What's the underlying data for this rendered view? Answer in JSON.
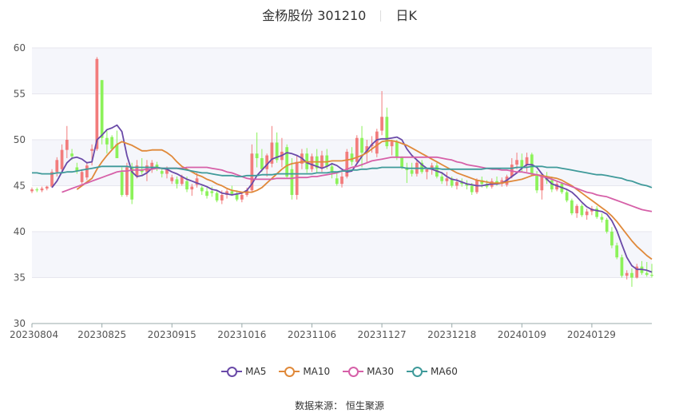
{
  "title": {
    "name": "金杨股份 301210",
    "period": "日K"
  },
  "source": "数据来源： 恒生聚源",
  "colors": {
    "up": "#f27c7c",
    "down": "#8cf25a",
    "ma5": "#6a4aa8",
    "ma10": "#e0893a",
    "ma30": "#d660a8",
    "ma60": "#3f9a9a",
    "grid": "#e6e6ee",
    "band": "#f5f6fb"
  },
  "chart_data": {
    "type": "candlestick",
    "ylim": [
      30,
      60
    ],
    "yticks": [
      30,
      35,
      40,
      45,
      50,
      55,
      60
    ],
    "xtick_labels": [
      "20230804",
      "20230825",
      "20230915",
      "20231016",
      "20231106",
      "20231127",
      "20231218",
      "20240109",
      "20240129"
    ],
    "xtick_index": [
      0,
      14,
      28,
      42,
      56,
      70,
      84,
      98,
      112
    ],
    "candles": [
      [
        44.4,
        44.8,
        44.2,
        44.6
      ],
      [
        44.6,
        44.8,
        44.3,
        44.5
      ],
      [
        44.5,
        44.9,
        44.3,
        44.7
      ],
      [
        44.7,
        45.0,
        44.5,
        44.9
      ],
      [
        44.9,
        46.8,
        44.8,
        46.5
      ],
      [
        46.5,
        48.1,
        46.0,
        47.8
      ],
      [
        46.8,
        49.5,
        46.5,
        48.9
      ],
      [
        48.9,
        51.5,
        48.0,
        50.0
      ],
      [
        48.5,
        49.0,
        47.8,
        48.2
      ],
      [
        47.0,
        47.5,
        46.3,
        46.6
      ],
      [
        45.4,
        46.8,
        45.2,
        46.5
      ],
      [
        45.9,
        47.6,
        45.6,
        47.2
      ],
      [
        48.8,
        49.5,
        47.2,
        49.0
      ],
      [
        49.0,
        59.0,
        48.8,
        58.8
      ],
      [
        56.5,
        56.5,
        49.5,
        50.2
      ],
      [
        50.2,
        51.0,
        48.5,
        49.5
      ],
      [
        50.3,
        50.5,
        48.9,
        49.0
      ],
      [
        49.5,
        51.0,
        48.0,
        48.0
      ],
      [
        46.5,
        47.0,
        43.8,
        44.0
      ],
      [
        44.0,
        47.5,
        43.8,
        47.0
      ],
      [
        47.0,
        47.5,
        43.0,
        43.5
      ],
      [
        46.0,
        47.8,
        45.8,
        47.2
      ],
      [
        46.8,
        48.0,
        46.2,
        46.5
      ],
      [
        46.5,
        47.8,
        45.5,
        47.2
      ],
      [
        47.0,
        47.8,
        46.4,
        47.5
      ],
      [
        47.3,
        47.6,
        46.6,
        47.0
      ],
      [
        46.6,
        47.0,
        45.9,
        46.3
      ],
      [
        46.3,
        47.1,
        45.8,
        46.9
      ],
      [
        45.5,
        46.2,
        45.2,
        45.9
      ],
      [
        45.7,
        46.0,
        44.7,
        45.2
      ],
      [
        45.2,
        46.2,
        45.0,
        46.0
      ],
      [
        45.5,
        46.0,
        44.3,
        44.6
      ],
      [
        44.6,
        45.2,
        43.9,
        44.9
      ],
      [
        45.1,
        46.4,
        44.8,
        45.8
      ],
      [
        44.8,
        45.0,
        44.0,
        44.4
      ],
      [
        44.4,
        44.8,
        43.6,
        43.9
      ],
      [
        44.4,
        44.9,
        43.8,
        44.2
      ],
      [
        44.2,
        44.5,
        43.2,
        43.4
      ],
      [
        43.4,
        44.5,
        43.0,
        44.0
      ],
      [
        44.0,
        44.6,
        43.6,
        44.4
      ],
      [
        44.4,
        45.0,
        43.9,
        44.1
      ],
      [
        44.1,
        44.5,
        43.3,
        43.5
      ],
      [
        43.5,
        44.3,
        43.2,
        44.0
      ],
      [
        44.0,
        44.8,
        43.8,
        44.5
      ],
      [
        44.5,
        49.5,
        44.3,
        48.5
      ],
      [
        48.5,
        50.8,
        47.0,
        48.0
      ],
      [
        48.0,
        49.0,
        46.5,
        46.8
      ],
      [
        46.8,
        48.5,
        46.0,
        48.3
      ],
      [
        47.4,
        51.5,
        47.0,
        49.7
      ],
      [
        49.7,
        50.8,
        47.5,
        47.8
      ],
      [
        47.8,
        50.2,
        47.0,
        48.7
      ],
      [
        49.2,
        49.5,
        45.8,
        46.0
      ],
      [
        46.8,
        48.0,
        43.5,
        44.0
      ],
      [
        44.0,
        48.3,
        43.5,
        47.6
      ],
      [
        47.4,
        49.0,
        46.8,
        48.5
      ],
      [
        48.5,
        49.1,
        46.4,
        46.8
      ],
      [
        46.8,
        48.5,
        46.5,
        48.2
      ],
      [
        48.2,
        49.0,
        46.4,
        46.9
      ],
      [
        46.9,
        48.8,
        46.5,
        48.3
      ],
      [
        48.3,
        49.0,
        46.8,
        47.1
      ],
      [
        47.1,
        47.5,
        45.8,
        46.4
      ],
      [
        45.8,
        46.4,
        45.0,
        45.2
      ],
      [
        45.2,
        46.5,
        44.8,
        46.0
      ],
      [
        46.0,
        49.0,
        45.8,
        48.7
      ],
      [
        48.5,
        49.2,
        47.2,
        47.6
      ],
      [
        47.6,
        50.5,
        47.4,
        50.2
      ],
      [
        50.2,
        51.5,
        47.0,
        48.6
      ],
      [
        48.6,
        50.0,
        47.5,
        49.3
      ],
      [
        49.3,
        50.4,
        48.6,
        49.5
      ],
      [
        48.5,
        51.2,
        48.1,
        50.9
      ],
      [
        51.0,
        55.3,
        50.5,
        52.5
      ],
      [
        52.5,
        53.5,
        49.0,
        49.3
      ],
      [
        49.3,
        50.0,
        48.3,
        49.8
      ],
      [
        49.8,
        50.0,
        47.8,
        48.1
      ],
      [
        48.1,
        48.2,
        46.8,
        47.0
      ],
      [
        47.0,
        47.5,
        45.3,
        46.7
      ],
      [
        46.7,
        47.5,
        46.0,
        46.3
      ],
      [
        46.3,
        47.8,
        46.0,
        47.5
      ],
      [
        47.5,
        47.8,
        46.3,
        46.5
      ],
      [
        46.5,
        47.0,
        45.7,
        46.8
      ],
      [
        46.8,
        47.5,
        46.2,
        47.2
      ],
      [
        47.2,
        47.5,
        45.8,
        46.0
      ],
      [
        46.0,
        46.5,
        45.2,
        45.5
      ],
      [
        45.5,
        46.5,
        45.0,
        45.8
      ],
      [
        45.8,
        46.0,
        44.8,
        45.0
      ],
      [
        45.0,
        45.8,
        44.6,
        45.4
      ],
      [
        45.4,
        45.8,
        44.9,
        45.2
      ],
      [
        45.2,
        45.6,
        44.6,
        45.0
      ],
      [
        45.0,
        45.3,
        44.0,
        44.3
      ],
      [
        44.3,
        45.8,
        44.1,
        45.6
      ],
      [
        45.6,
        46.0,
        44.8,
        45.2
      ],
      [
        45.2,
        45.6,
        44.7,
        44.9
      ],
      [
        44.9,
        45.8,
        44.7,
        45.5
      ],
      [
        45.5,
        46.0,
        45.0,
        45.2
      ],
      [
        45.2,
        45.9,
        44.9,
        45.6
      ],
      [
        45.1,
        46.2,
        44.9,
        46.0
      ],
      [
        46.0,
        48.0,
        45.8,
        47.3
      ],
      [
        47.3,
        48.6,
        46.8,
        47.8
      ],
      [
        47.8,
        48.5,
        46.5,
        47.0
      ],
      [
        47.3,
        48.6,
        46.5,
        48.1
      ],
      [
        48.4,
        48.6,
        46.1,
        46.2
      ],
      [
        46.1,
        46.6,
        44.2,
        44.5
      ],
      [
        44.5,
        46.2,
        43.5,
        46.0
      ],
      [
        46.0,
        46.5,
        45.2,
        45.6
      ],
      [
        45.6,
        46.0,
        44.3,
        44.6
      ],
      [
        44.6,
        45.5,
        44.4,
        45.2
      ],
      [
        45.2,
        45.4,
        44.1,
        44.3
      ],
      [
        44.3,
        44.6,
        43.2,
        43.4
      ],
      [
        43.4,
        43.6,
        41.8,
        42.0
      ],
      [
        42.0,
        43.0,
        41.5,
        42.8
      ],
      [
        42.8,
        43.0,
        41.6,
        41.8
      ],
      [
        41.8,
        42.5,
        41.3,
        42.2
      ],
      [
        42.2,
        42.8,
        41.8,
        42.5
      ],
      [
        42.5,
        42.8,
        41.4,
        41.6
      ],
      [
        41.6,
        42.0,
        41.0,
        41.3
      ],
      [
        41.3,
        41.5,
        39.8,
        40.0
      ],
      [
        40.0,
        40.5,
        38.2,
        38.5
      ],
      [
        38.5,
        38.8,
        37.0,
        37.2
      ],
      [
        37.2,
        37.5,
        35.0,
        35.2
      ],
      [
        35.2,
        35.8,
        34.8,
        35.5
      ],
      [
        35.5,
        36.0,
        34.0,
        35.0
      ],
      [
        35.0,
        36.5,
        34.9,
        36.2
      ],
      [
        36.2,
        36.8,
        35.3,
        35.5
      ],
      [
        35.5,
        36.7,
        35.1,
        35.3
      ],
      [
        35.3,
        36.5,
        35.0,
        35.2
      ]
    ],
    "series": [
      {
        "name": "MA5",
        "color": "#6a4aa8",
        "values": [
          null,
          null,
          null,
          null,
          44.8,
          45.5,
          46.5,
          47.5,
          48.0,
          48.1,
          47.9,
          47.5,
          47.6,
          50.0,
          50.5,
          51.1,
          51.3,
          51.6,
          50.9,
          48.3,
          46.5,
          46.0,
          46.1,
          46.4,
          46.9,
          47.0,
          46.9,
          46.8,
          46.5,
          46.3,
          46.0,
          45.7,
          45.5,
          45.3,
          45.1,
          44.9,
          44.6,
          44.5,
          44.2,
          44.1,
          44.0,
          44.1,
          44.2,
          44.5,
          45.2,
          46.1,
          46.7,
          47.3,
          47.9,
          48.1,
          48.3,
          48.6,
          48.5,
          48.3,
          48.0,
          47.5,
          47.3,
          47.1,
          46.9,
          47.1,
          47.4,
          47.2,
          46.8,
          46.5,
          46.6,
          47.4,
          48.2,
          48.8,
          49.5,
          50.0,
          50.1,
          50.1,
          50.2,
          50.3,
          50.0,
          49.0,
          48.3,
          47.8,
          47.3,
          46.9,
          46.8,
          46.6,
          46.4,
          46.0,
          45.7,
          45.6,
          45.4,
          45.2,
          45.1,
          45.0,
          45.0,
          45.1,
          45.2,
          45.2,
          45.3,
          45.6,
          46.0,
          46.4,
          46.9,
          47.3,
          47.3,
          47.0,
          46.3,
          45.7,
          45.2,
          45.0,
          44.8,
          44.6,
          44.3,
          43.8,
          43.2,
          42.7,
          42.4,
          42.3,
          42.2,
          41.9,
          41.2,
          40.1,
          38.6,
          37.2,
          36.3,
          35.9,
          35.9,
          35.8,
          35.6
        ]
      },
      {
        "name": "MA10",
        "color": "#e0893a",
        "values": [
          null,
          null,
          null,
          null,
          null,
          null,
          null,
          null,
          null,
          44.6,
          45.0,
          45.4,
          45.8,
          46.8,
          47.6,
          48.3,
          48.9,
          49.5,
          49.8,
          49.6,
          49.4,
          49.1,
          48.8,
          48.8,
          48.9,
          48.9,
          48.9,
          48.6,
          48.2,
          47.6,
          47.1,
          46.8,
          46.5,
          46.2,
          46.0,
          45.7,
          45.5,
          45.2,
          45.0,
          44.7,
          44.5,
          44.4,
          44.3,
          44.3,
          44.3,
          44.5,
          44.8,
          45.3,
          45.8,
          46.3,
          46.8,
          47.2,
          47.4,
          47.5,
          47.6,
          47.6,
          47.6,
          47.6,
          47.6,
          47.6,
          47.7,
          47.7,
          47.7,
          47.8,
          47.9,
          48.1,
          48.3,
          48.6,
          49.0,
          49.4,
          49.8,
          49.9,
          49.9,
          49.8,
          49.6,
          49.4,
          49.1,
          48.8,
          48.5,
          48.2,
          47.9,
          47.6,
          47.3,
          47.0,
          46.7,
          46.4,
          46.2,
          46.0,
          45.8,
          45.6,
          45.5,
          45.4,
          45.3,
          45.3,
          45.3,
          45.4,
          45.5,
          45.6,
          45.7,
          45.9,
          46.1,
          46.2,
          46.1,
          46.0,
          45.9,
          45.8,
          45.6,
          45.3,
          45.0,
          44.6,
          44.2,
          43.8,
          43.4,
          43.0,
          42.6,
          42.2,
          41.7,
          41.1,
          40.4,
          39.7,
          39.0,
          38.4,
          37.9,
          37.4,
          37.0
        ]
      },
      {
        "name": "MA30",
        "color": "#d660a8",
        "values": [
          null,
          null,
          null,
          null,
          null,
          null,
          44.3,
          44.5,
          44.7,
          44.9,
          45.1,
          45.3,
          45.5,
          45.7,
          45.9,
          46.1,
          46.3,
          46.5,
          46.6,
          46.6,
          46.7,
          46.7,
          46.7,
          46.8,
          46.8,
          46.9,
          46.9,
          46.9,
          46.9,
          46.9,
          46.9,
          47.0,
          47.0,
          47.0,
          47.0,
          47.0,
          46.9,
          46.8,
          46.7,
          46.5,
          46.4,
          46.2,
          46.0,
          45.8,
          45.7,
          45.7,
          45.7,
          45.7,
          45.7,
          45.8,
          45.8,
          45.8,
          45.8,
          45.9,
          45.9,
          45.9,
          46.0,
          46.0,
          46.1,
          46.2,
          46.3,
          46.4,
          46.6,
          46.8,
          47.0,
          47.1,
          47.3,
          47.5,
          47.7,
          47.8,
          47.9,
          48.0,
          48.1,
          48.1,
          48.1,
          48.1,
          48.1,
          48.1,
          48.1,
          48.1,
          48.1,
          48.1,
          48.0,
          47.9,
          47.8,
          47.6,
          47.5,
          47.3,
          47.2,
          47.1,
          47.0,
          46.9,
          46.8,
          46.8,
          46.7,
          46.7,
          46.6,
          46.5,
          46.5,
          46.4,
          46.3,
          46.2,
          46.0,
          45.9,
          45.7,
          45.5,
          45.3,
          45.1,
          44.9,
          44.7,
          44.5,
          44.3,
          44.2,
          44.0,
          43.9,
          43.8,
          43.6,
          43.4,
          43.2,
          43.0,
          42.8,
          42.6,
          42.4,
          42.3,
          42.2
        ]
      },
      {
        "name": "MA60",
        "color": "#3f9a9a",
        "values": [
          46.4,
          46.4,
          46.3,
          46.3,
          46.3,
          46.4,
          46.4,
          46.5,
          46.5,
          46.6,
          46.7,
          46.8,
          46.9,
          47.0,
          47.1,
          47.1,
          47.1,
          47.1,
          47.1,
          47.1,
          47.0,
          47.0,
          47.0,
          47.0,
          47.0,
          47.0,
          46.9,
          46.9,
          46.9,
          46.9,
          46.8,
          46.7,
          46.6,
          46.5,
          46.4,
          46.4,
          46.3,
          46.2,
          46.1,
          46.1,
          46.1,
          46.0,
          46.0,
          46.1,
          46.1,
          46.1,
          46.2,
          46.2,
          46.2,
          46.3,
          46.3,
          46.3,
          46.3,
          46.3,
          46.3,
          46.3,
          46.3,
          46.4,
          46.4,
          46.4,
          46.5,
          46.5,
          46.6,
          46.6,
          46.7,
          46.7,
          46.8,
          46.8,
          46.9,
          46.9,
          47.0,
          47.0,
          47.0,
          47.0,
          47.0,
          46.9,
          46.9,
          46.9,
          46.9,
          46.9,
          46.9,
          46.9,
          46.8,
          46.8,
          46.8,
          46.8,
          46.8,
          46.8,
          46.8,
          46.8,
          46.8,
          46.9,
          46.9,
          46.9,
          46.9,
          46.9,
          46.9,
          47.0,
          47.0,
          47.0,
          47.1,
          47.1,
          47.1,
          47.0,
          47.0,
          47.0,
          46.9,
          46.8,
          46.7,
          46.6,
          46.5,
          46.4,
          46.3,
          46.2,
          46.2,
          46.1,
          46.0,
          45.9,
          45.8,
          45.6,
          45.5,
          45.3,
          45.1,
          45.0,
          44.8
        ]
      }
    ],
    "legend": [
      "MA5",
      "MA10",
      "MA30",
      "MA60"
    ],
    "legend_position": "bottom"
  }
}
